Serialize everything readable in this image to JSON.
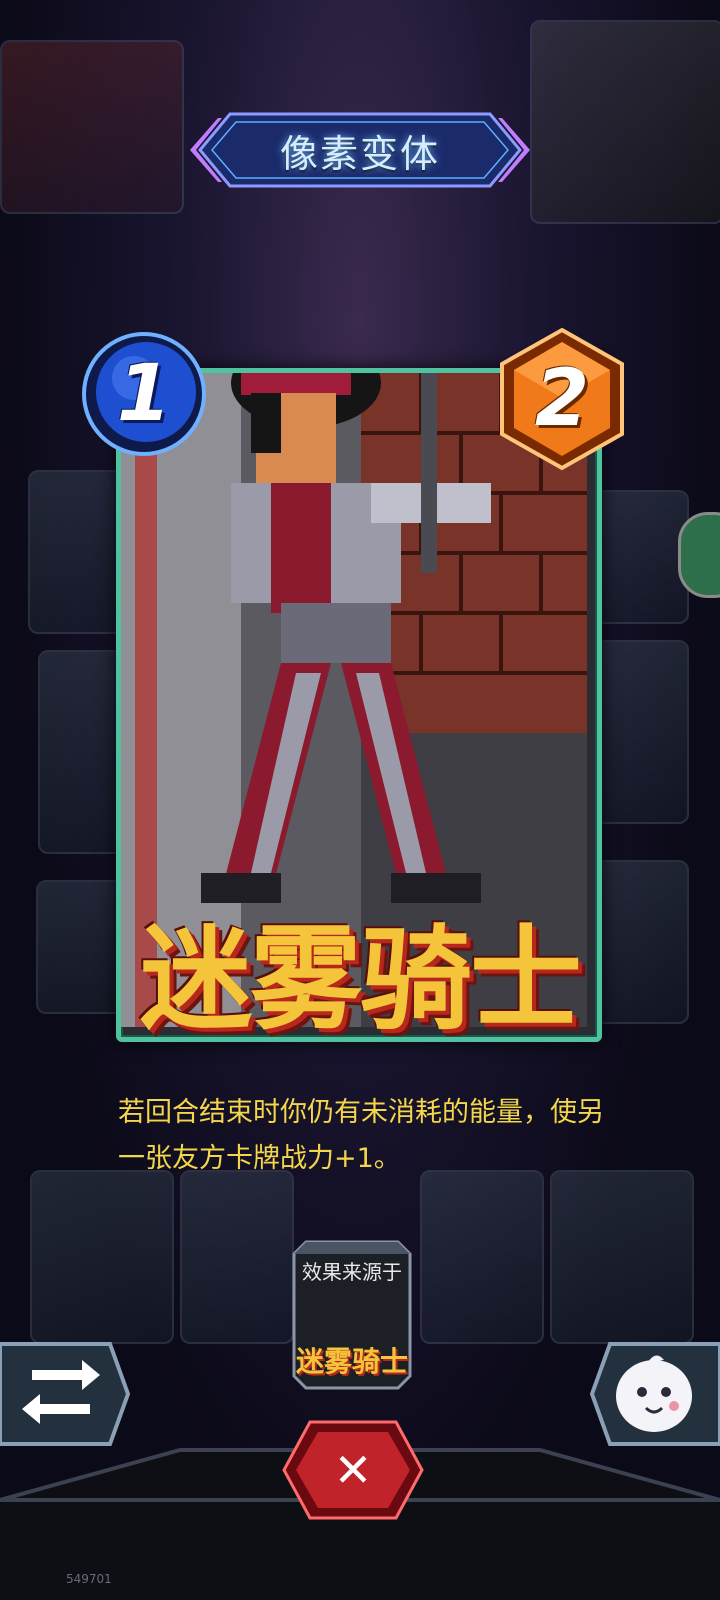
{
  "header": {
    "title": "像素变体"
  },
  "card": {
    "cost": "1",
    "power": "2",
    "name": "迷雾骑士",
    "description": "若回合结束时你仍有未消耗的能量，使另一张友方卡牌战力+1。"
  },
  "source": {
    "label": "效果来源于",
    "card_name": "迷雾骑士"
  },
  "buttons": {
    "swap": "swap-arrows-icon",
    "close": "✕",
    "emote": "ghost-emote-icon"
  },
  "footer": {
    "id": "549701"
  },
  "colors": {
    "frame": "#4fc3a0",
    "cost_gem": "#1f4fd1",
    "power_gem": "#f07a1a",
    "description": "#f3d64a",
    "name_fill": "#f4c43a",
    "name_shadow": "#b8271c",
    "close_button": "#c0232a"
  }
}
